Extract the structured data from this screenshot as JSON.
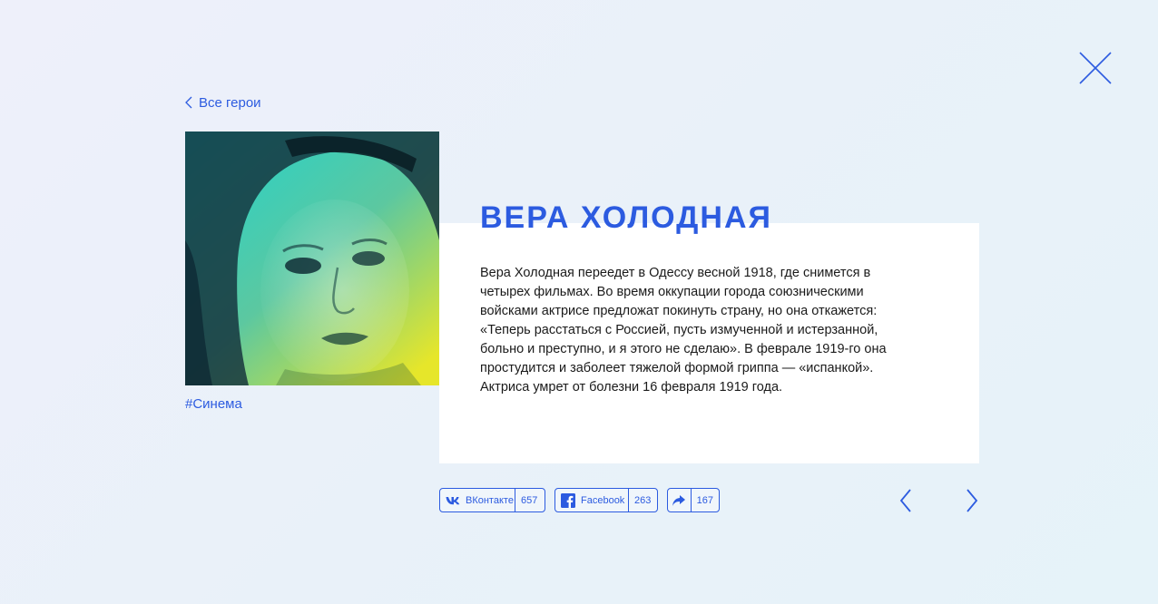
{
  "nav": {
    "back_label": "Все герои"
  },
  "hero": {
    "name": "ВЕРА ХОЛОДНАЯ",
    "tag": "#Синема",
    "bio": "Вера Холодная переедет в Одессу весной 1918, где снимется в четырех фильмах. Во время оккупации города союзническими войсками актрисе предложат покинуть страну, но она откажется: «Теперь расстаться с Россией, пусть измученной и истерзанной, больно и преступно, и я этого не сделаю». В феврале 1919-го она простудится и заболеет тяжелой формой гриппа — «испанкой». Актриса умрет от болезни 16 февраля 1919 года."
  },
  "share": {
    "vk": {
      "label": "ВКонтакте",
      "count": "657",
      "icon": "vk-icon"
    },
    "facebook": {
      "label": "Facebook",
      "count": "263",
      "icon": "facebook-icon"
    },
    "generic": {
      "count": "167",
      "icon": "share-arrow-icon"
    }
  },
  "colors": {
    "accent": "#2c5be0",
    "photo_gradient_top": "#1fd3cf",
    "photo_gradient_bottom": "#e6e62a"
  }
}
